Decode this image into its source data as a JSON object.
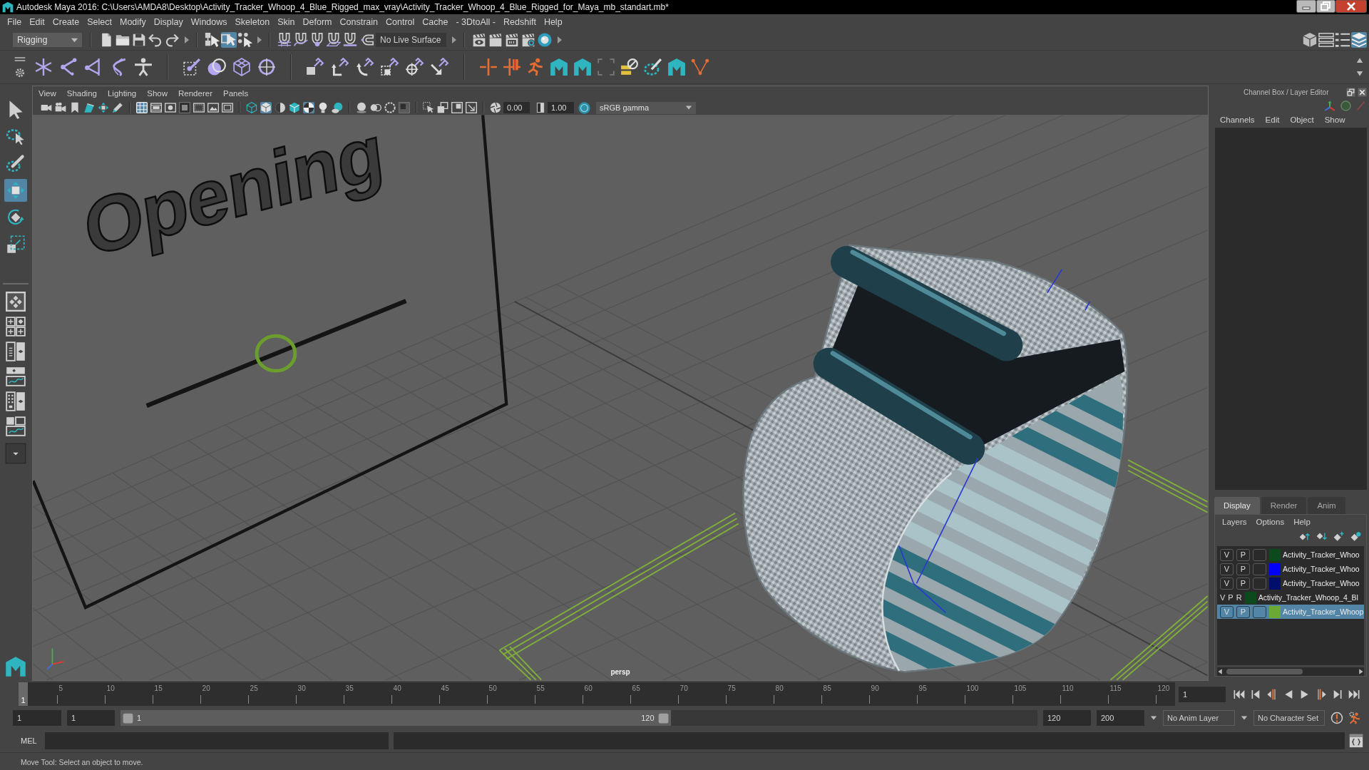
{
  "window": {
    "title": "Autodesk Maya 2016: C:\\Users\\AMDA8\\Desktop\\Activity_Tracker_Whoop_4_Blue_Rigged_max_vray\\Activity_Tracker_Whoop_4_Blue_Rigged_for_Maya_mb_standart.mb*"
  },
  "menu_bar": [
    "File",
    "Edit",
    "Create",
    "Select",
    "Modify",
    "Display",
    "Windows",
    "Skeleton",
    "Skin",
    "Deform",
    "Constrain",
    "Control",
    "Cache",
    "- 3DtoAll -",
    "Redshift",
    "Help"
  ],
  "status_line": {
    "menu_set": "Rigging",
    "selection_modes": [
      {
        "selected": false
      },
      {
        "selected": true
      },
      {
        "selected": false
      }
    ],
    "live_surface": "No Live Surface",
    "panel_toggles": [
      {
        "selected": false
      },
      {
        "selected": false
      },
      {
        "selected": false
      },
      {
        "selected": true
      }
    ]
  },
  "toolbox": {
    "tools": [
      {
        "selected": false
      },
      {
        "selected": false
      },
      {
        "selected": false
      },
      {
        "selected": true
      },
      {
        "selected": false
      },
      {
        "selected": false
      }
    ]
  },
  "viewport": {
    "menu": [
      "View",
      "Shading",
      "Lighting",
      "Show",
      "Renderer",
      "Panels"
    ],
    "toolbar": {
      "groups": [
        [
          {
            "selected": false
          },
          {
            "selected": false
          },
          {
            "selected": false
          },
          {
            "selected": false
          },
          {
            "selected": false
          },
          {
            "selected": false
          }
        ],
        [
          {
            "selected": true
          },
          {
            "selected": false
          },
          {
            "selected": false
          },
          {
            "selected": false
          },
          {
            "selected": false
          },
          {
            "selected": false
          },
          {
            "selected": false
          }
        ],
        [
          {
            "selected": false
          },
          {
            "selected": true
          },
          {
            "selected": false
          },
          {
            "selected": false
          },
          {
            "selected": true
          },
          {
            "selected": false
          },
          {
            "selected": false
          }
        ],
        [
          {
            "selected": false
          },
          {
            "selected": false
          },
          {
            "selected": false
          },
          {
            "selected": false
          }
        ],
        [
          {
            "selected": false
          },
          {
            "selected": false
          },
          {
            "selected": false
          },
          {
            "selected": false
          }
        ]
      ],
      "exposure": "0.00",
      "gamma": "1.00",
      "view_transform": "sRGB gamma"
    },
    "scene_text": "Opening",
    "camera": "persp"
  },
  "channel_box": {
    "title": "Channel Box / Layer Editor",
    "menu": [
      "Channels",
      "Edit",
      "Object",
      "Show"
    ]
  },
  "layer_editor": {
    "tabs": [
      {
        "label": "Display",
        "selected": true
      },
      {
        "label": "Render",
        "selected": false
      },
      {
        "label": "Anim",
        "selected": false
      }
    ],
    "menu": [
      "Layers",
      "Options",
      "Help"
    ],
    "layers": [
      {
        "kind": "local",
        "visibility": "V",
        "playback": "P",
        "color": "#0c4a1e",
        "name": "Activity_Tracker_Whoo",
        "selected": false
      },
      {
        "kind": "local",
        "visibility": "V",
        "playback": "P",
        "color": "#0000ff",
        "name": "Activity_Tracker_Whoo",
        "selected": false
      },
      {
        "kind": "local",
        "visibility": "V",
        "playback": "P",
        "color": "#000e6b",
        "name": "Activity_Tracker_Whoo",
        "selected": false
      },
      {
        "kind": "referenced",
        "visibility": "V",
        "playback": "P",
        "reference": "R",
        "color": "#0c4a1e",
        "name": "Activity_Tracker_Whoop_4_Bl",
        "selected": false
      },
      {
        "kind": "local",
        "visibility": "V",
        "playback": "P",
        "color": "#6aa934",
        "name": "Activity_Tracker_Whoop",
        "selected": true
      }
    ]
  },
  "time_slider": {
    "current_frame_marker": "1",
    "level": 0,
    "frame_labels": [
      "5",
      "10",
      "15",
      "20",
      "25",
      "30",
      "35",
      "40",
      "45",
      "50",
      "55",
      "60",
      "65",
      "70",
      "75",
      "80",
      "85",
      "90",
      "95",
      "100",
      "105",
      "110",
      "115",
      "120"
    ],
    "current_frame": "1"
  },
  "range_slider": {
    "start": "1",
    "playback_start": "1",
    "range_start": "1",
    "range_end": "120",
    "level": 0.6,
    "playback_end": "120",
    "end": "200",
    "anim_layer": "No Anim Layer",
    "character_set": "No Character Set"
  },
  "command_line": {
    "language": "MEL"
  },
  "help_line": "Move Tool: Select an object to move."
}
